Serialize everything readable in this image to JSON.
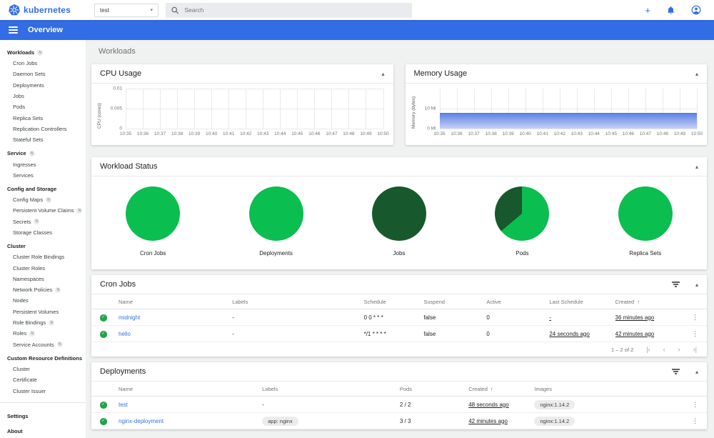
{
  "colors": {
    "brand_blue": "#326ce5",
    "appbar_blue": "#326de6",
    "link_blue": "#3571e3",
    "running_green": "#0abe50",
    "succeeded_dark_green": "#17592c",
    "check_green": "#23a24d",
    "memory_area_blue": "#5f84e6"
  },
  "glyphs": {
    "collapse": "▴",
    "select_caret": "▾",
    "menu_dots": "⋮",
    "sort_asc": "↑",
    "plus": "+",
    "check": "✓",
    "first_page": "|‹",
    "prev_page": "‹",
    "next_page": "›",
    "last_page": "›|"
  },
  "header": {
    "logo_text": "kubernetes",
    "namespace_value": "test",
    "search_placeholder": "Search"
  },
  "appbar": {
    "title": "Overview"
  },
  "page_title": "Workloads",
  "sidebar": {
    "groups": [
      {
        "label": "Workloads",
        "badge": "N",
        "items": [
          {
            "label": "Cron Jobs"
          },
          {
            "label": "Daemon Sets"
          },
          {
            "label": "Deployments"
          },
          {
            "label": "Jobs"
          },
          {
            "label": "Pods"
          },
          {
            "label": "Replica Sets"
          },
          {
            "label": "Replication Controllers"
          },
          {
            "label": "Stateful Sets"
          }
        ]
      },
      {
        "label": "Service",
        "badge": "N",
        "items": [
          {
            "label": "Ingresses"
          },
          {
            "label": "Services"
          }
        ]
      },
      {
        "label": "Config and Storage",
        "items": [
          {
            "label": "Config Maps",
            "badge": "N"
          },
          {
            "label": "Persistent Volume Claims",
            "badge": "N"
          },
          {
            "label": "Secrets",
            "badge": "N"
          },
          {
            "label": "Storage Classes"
          }
        ]
      },
      {
        "label": "Cluster",
        "items": [
          {
            "label": "Cluster Role Bindings"
          },
          {
            "label": "Cluster Roles"
          },
          {
            "label": "Namespaces"
          },
          {
            "label": "Network Policies",
            "badge": "N"
          },
          {
            "label": "Nodes"
          },
          {
            "label": "Persistent Volumes"
          },
          {
            "label": "Role Bindings",
            "badge": "N"
          },
          {
            "label": "Roles",
            "badge": "N"
          },
          {
            "label": "Service Accounts",
            "badge": "N"
          }
        ]
      },
      {
        "label": "Custom Resource Definitions",
        "items": [
          {
            "label": "Cluster"
          },
          {
            "label": "Certificate"
          },
          {
            "label": "Cluster Issuer"
          }
        ]
      }
    ],
    "footer_items": [
      {
        "label": "Settings"
      },
      {
        "label": "About"
      }
    ]
  },
  "cpu_chart": {
    "title": "CPU Usage",
    "ylabel": "CPU (cores)",
    "yticks": [
      {
        "label": "0.01",
        "pos": 0
      },
      {
        "label": "0.005",
        "pos": 50
      },
      {
        "label": "0",
        "pos": 100
      }
    ],
    "xticks": [
      "10:35",
      "10:36",
      "10:37",
      "10:38",
      "10:39",
      "10:40",
      "10:41",
      "10:42",
      "10:43",
      "10:44",
      "10:45",
      "10:46",
      "10:47",
      "10:48",
      "10:49",
      "10:50"
    ],
    "fill_height_pct": 0
  },
  "memory_chart": {
    "title": "Memory Usage",
    "ylabel": "Memory (bytes)",
    "yticks": [
      {
        "label": "10 Mi",
        "pos": 50
      },
      {
        "label": "0 Mi",
        "pos": 100
      }
    ],
    "xticks": [
      "10:35",
      "10:36",
      "10:37",
      "10:38",
      "10:39",
      "10:40",
      "10:41",
      "10:42",
      "10:43",
      "10:44",
      "10:45",
      "10:46",
      "10:47",
      "10:48",
      "10:49",
      "10:50"
    ],
    "fill_height_pct": 40,
    "approx_value": "8 Mi"
  },
  "workload_status": {
    "title": "Workload Status",
    "pies": [
      {
        "label": "Cron Jobs",
        "slices": [
          {
            "status": "running",
            "color": "#0abe50",
            "deg": 360
          }
        ]
      },
      {
        "label": "Deployments",
        "slices": [
          {
            "status": "running",
            "color": "#0abe50",
            "deg": 360
          }
        ]
      },
      {
        "label": "Jobs",
        "slices": [
          {
            "status": "succeeded",
            "color": "#17592c",
            "deg": 360
          }
        ]
      },
      {
        "label": "Pods",
        "slices": [
          {
            "status": "running",
            "color": "#0abe50",
            "deg": 230
          },
          {
            "status": "succeeded",
            "color": "#17592c",
            "deg": 130
          }
        ]
      },
      {
        "label": "Replica Sets",
        "slices": [
          {
            "status": "running",
            "color": "#0abe50",
            "deg": 360
          }
        ]
      }
    ]
  },
  "cron_jobs": {
    "title": "Cron Jobs",
    "columns": [
      "Name",
      "Labels",
      "Schedule",
      "Suspend",
      "Active",
      "Last Schedule",
      "Created"
    ],
    "sorted_column": "Created",
    "rows": [
      {
        "name": "midnight",
        "labels": "-",
        "schedule": "0 0 * * *",
        "suspend": "false",
        "active": "0",
        "last_schedule": "-",
        "created": "36 minutes ago"
      },
      {
        "name": "hello",
        "labels": "-",
        "schedule": "*/1 * * * *",
        "suspend": "false",
        "active": "0",
        "last_schedule": "24 seconds ago",
        "created": "42 minutes ago"
      }
    ],
    "pagination": {
      "range_label": "1 – 2 of 2"
    }
  },
  "deployments": {
    "title": "Deployments",
    "columns": [
      "Name",
      "Labels",
      "Pods",
      "Created",
      "Images"
    ],
    "sorted_column": "Created",
    "rows": [
      {
        "name": "test",
        "labels_text": "-",
        "labels_chip": null,
        "pods": "2 / 2",
        "created": "48 seconds ago",
        "images_chip": "nginx:1.14.2"
      },
      {
        "name": "nginx-deployment",
        "labels_text": null,
        "labels_chip": "app: nginx",
        "pods": "3 / 3",
        "created": "42 minutes ago",
        "images_chip": "nginx:1.14.2"
      }
    ]
  }
}
